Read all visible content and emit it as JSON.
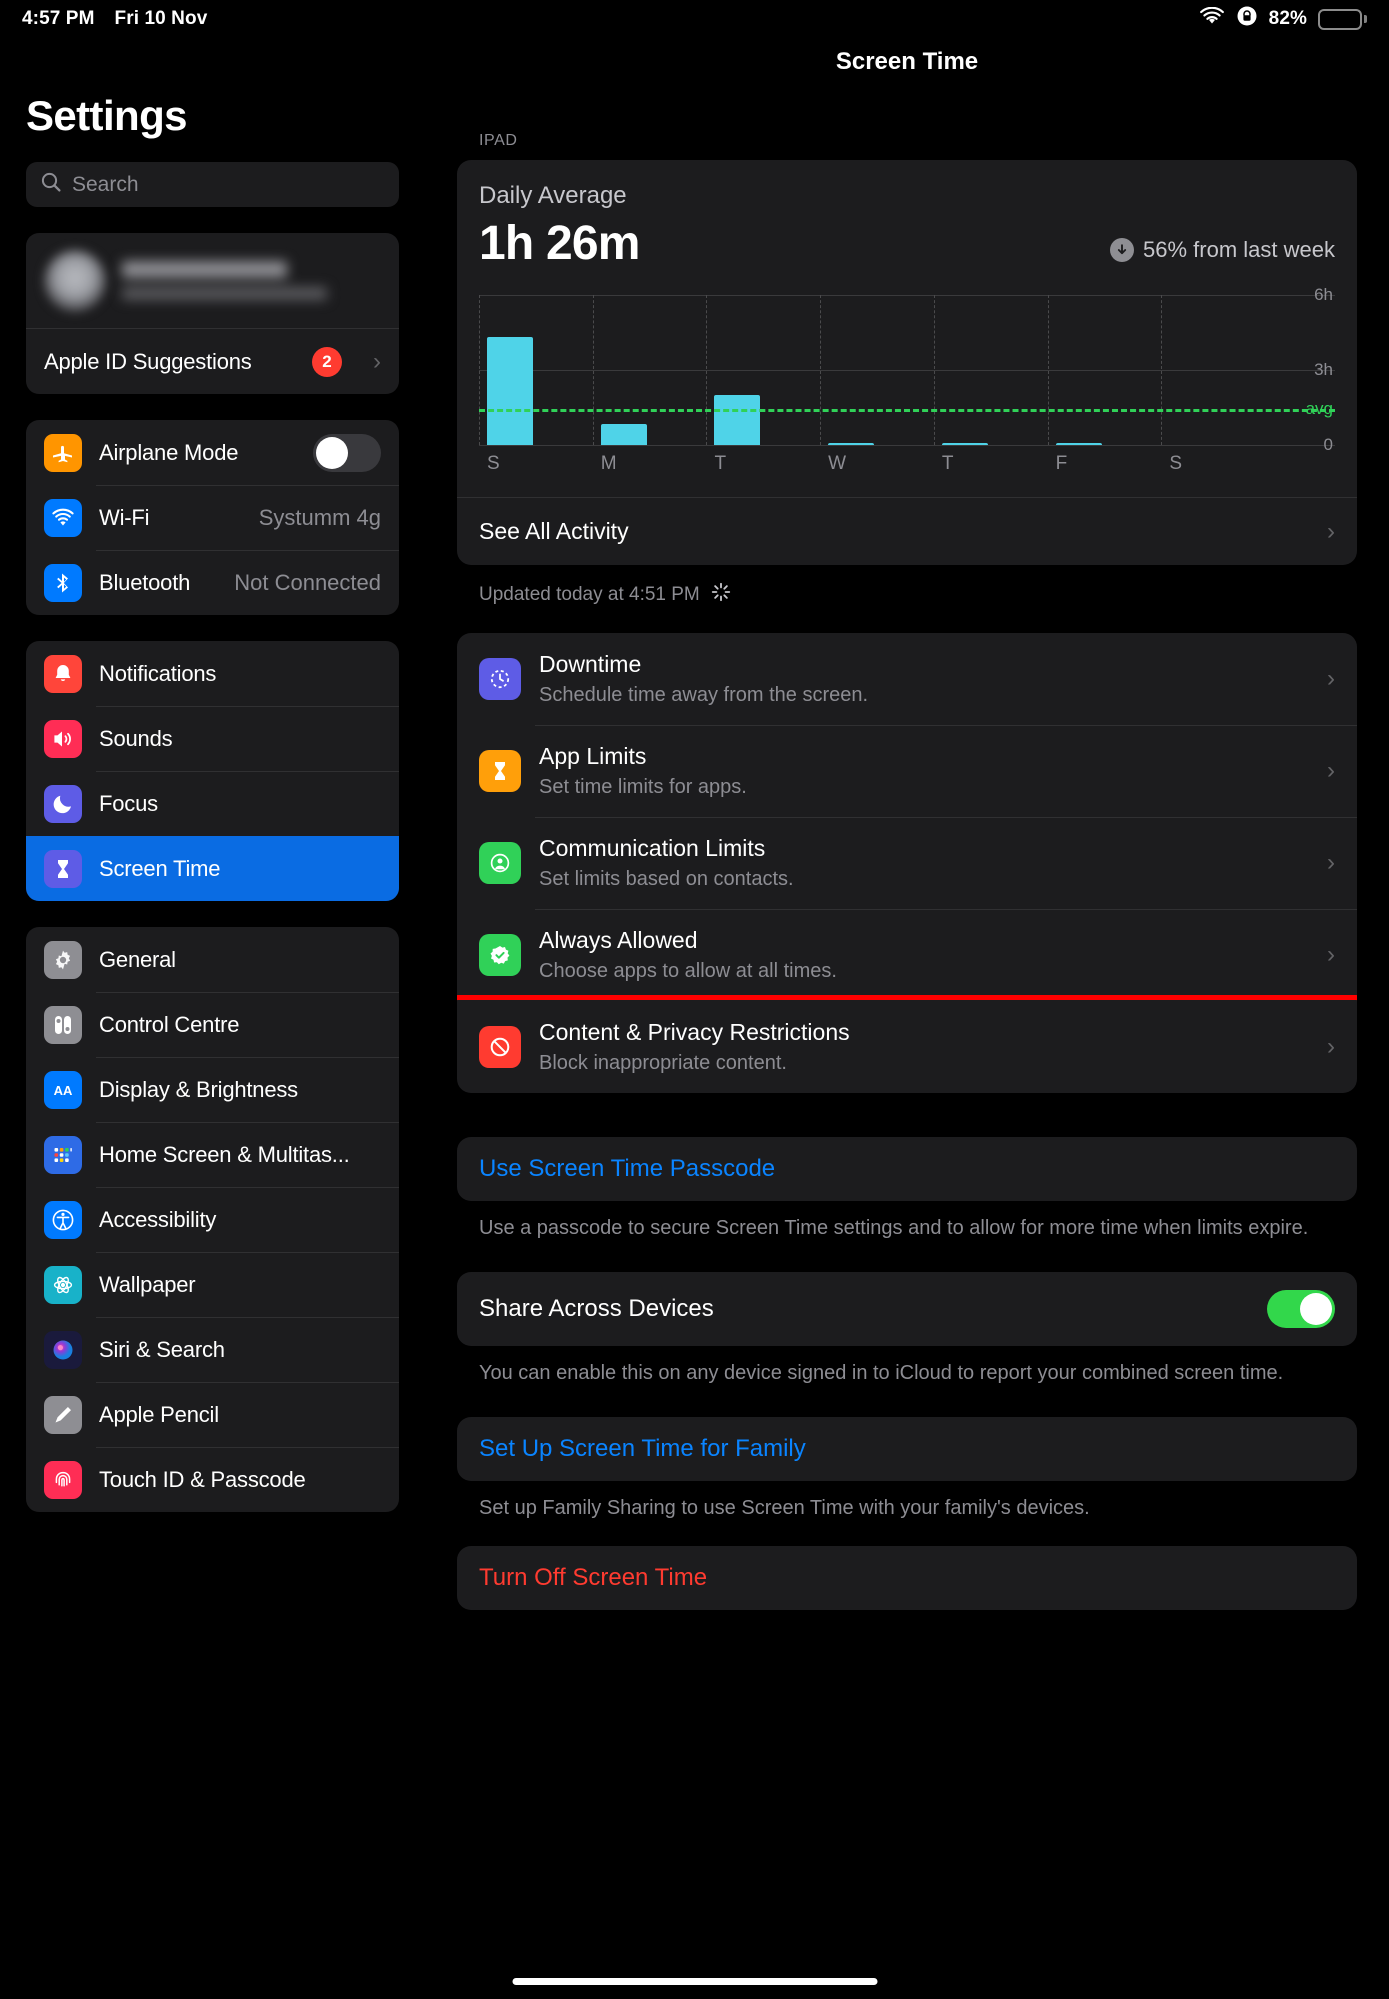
{
  "status_bar": {
    "time": "4:57 PM",
    "date": "Fri 10 Nov",
    "wifi_icon": "wifi-icon",
    "rotation_lock_icon": "rotation-lock-icon",
    "battery_percent": "82%",
    "battery_level": 82
  },
  "sidebar": {
    "title": "Settings",
    "search": {
      "placeholder": "Search",
      "value": "",
      "icon": "search-icon"
    },
    "account": {
      "redacted": true
    },
    "apple_id_suggestions": {
      "label": "Apple ID Suggestions",
      "badge": "2"
    },
    "group1": [
      {
        "label": "Airplane Mode",
        "icon": "airplane-icon",
        "type": "toggle",
        "on": false,
        "color": "#ff9500"
      },
      {
        "label": "Wi-Fi",
        "icon": "wifi-icon",
        "type": "value",
        "value": "Systumm 4g",
        "color": "#007aff"
      },
      {
        "label": "Bluetooth",
        "icon": "bluetooth-icon",
        "type": "value",
        "value": "Not Connected",
        "color": "#007aff"
      }
    ],
    "group2": [
      {
        "label": "Notifications",
        "icon": "bell-icon",
        "color": "#ff453a"
      },
      {
        "label": "Sounds",
        "icon": "speaker-icon",
        "color": "#ff2d55"
      },
      {
        "label": "Focus",
        "icon": "moon-icon",
        "color": "#5e5ce6"
      },
      {
        "label": "Screen Time",
        "icon": "hourglass-icon",
        "color": "#5e5ce6",
        "selected": true
      }
    ],
    "group3": [
      {
        "label": "General",
        "icon": "gear-icon",
        "color": "#8e8e93"
      },
      {
        "label": "Control Centre",
        "icon": "sliders-icon",
        "color": "#8e8e93"
      },
      {
        "label": "Display & Brightness",
        "icon": "aa-icon",
        "color": "#007aff"
      },
      {
        "label": "Home Screen & Multitas...",
        "icon": "grid-icon",
        "color": "#2e6be6"
      },
      {
        "label": "Accessibility",
        "icon": "accessibility-icon",
        "color": "#007aff"
      },
      {
        "label": "Wallpaper",
        "icon": "flower-icon",
        "color": "#18b2c9"
      },
      {
        "label": "Siri & Search",
        "icon": "siri-icon",
        "color": "#2b2b6e"
      },
      {
        "label": "Apple Pencil",
        "icon": "pencil-icon",
        "color": "#8e8e93"
      },
      {
        "label": "Touch ID & Passcode",
        "icon": "fingerprint-icon",
        "color": "#ff2d55"
      }
    ]
  },
  "detail": {
    "title": "Screen Time",
    "section_header": "IPAD",
    "summary": {
      "daily_average_label": "Daily Average",
      "daily_average_value": "1h 26m",
      "delta_text": "56% from last week",
      "delta_icon": "arrow-down-circle-icon"
    },
    "see_all_activity": "See All Activity",
    "updated": "Updated today at 4:51 PM",
    "spinner_icon": "loading-spinner-icon",
    "options": [
      {
        "title": "Downtime",
        "subtitle": "Schedule time away from the screen.",
        "icon": "downtime-icon",
        "color": "#5e5ce6"
      },
      {
        "title": "App Limits",
        "subtitle": "Set time limits for apps.",
        "icon": "hourglass-icon",
        "color": "#ff9f0a"
      },
      {
        "title": "Communication Limits",
        "subtitle": "Set limits based on contacts.",
        "icon": "person-circle-icon",
        "color": "#30d158"
      },
      {
        "title": "Always Allowed",
        "subtitle": "Choose apps to allow at all times.",
        "icon": "check-badge-icon",
        "color": "#30d158"
      },
      {
        "title": "Content & Privacy Restrictions",
        "subtitle": "Block inappropriate content.",
        "icon": "no-entry-icon",
        "color": "#ff3b30",
        "highlighted": true
      }
    ],
    "passcode": {
      "label": "Use Screen Time Passcode",
      "footnote": "Use a passcode to secure Screen Time settings and to allow for more time when limits expire."
    },
    "share": {
      "label": "Share Across Devices",
      "on": true,
      "footnote": "You can enable this on any device signed in to iCloud to report your combined screen time."
    },
    "family": {
      "label": "Set Up Screen Time for Family",
      "footnote": "Set up Family Sharing to use Screen Time with your family's devices."
    },
    "turn_off": "Turn Off Screen Time",
    "highlight_color": "#ff0000",
    "accent_color": "#0a84ff",
    "bar_color": "#4fd3e8",
    "avg_line_color": "#30d158"
  },
  "chart_data": {
    "type": "bar",
    "title": "Daily Average",
    "categories": [
      "S",
      "M",
      "T",
      "W",
      "T",
      "F",
      "S"
    ],
    "values": [
      4.3,
      0.85,
      2.0,
      0.06,
      0.06,
      0.06,
      0
    ],
    "unit": "hours",
    "ylim": [
      0,
      6
    ],
    "yticks": [
      0,
      3,
      6
    ],
    "ytick_labels": [
      "0",
      "3h",
      "6h"
    ],
    "average_line": {
      "value": 1.43,
      "label": "avg",
      "color": "#30d158",
      "style": "dashed"
    },
    "xlabel": "",
    "ylabel": "",
    "grid": true,
    "legend": "none"
  }
}
